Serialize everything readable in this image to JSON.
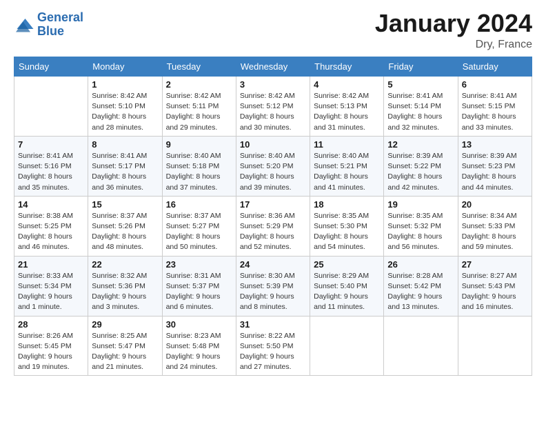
{
  "header": {
    "logo_line1": "General",
    "logo_line2": "Blue",
    "month_title": "January 2024",
    "location": "Dry, France"
  },
  "days_of_week": [
    "Sunday",
    "Monday",
    "Tuesday",
    "Wednesday",
    "Thursday",
    "Friday",
    "Saturday"
  ],
  "weeks": [
    [
      {
        "day": "",
        "info": ""
      },
      {
        "day": "1",
        "info": "Sunrise: 8:42 AM\nSunset: 5:10 PM\nDaylight: 8 hours\nand 28 minutes."
      },
      {
        "day": "2",
        "info": "Sunrise: 8:42 AM\nSunset: 5:11 PM\nDaylight: 8 hours\nand 29 minutes."
      },
      {
        "day": "3",
        "info": "Sunrise: 8:42 AM\nSunset: 5:12 PM\nDaylight: 8 hours\nand 30 minutes."
      },
      {
        "day": "4",
        "info": "Sunrise: 8:42 AM\nSunset: 5:13 PM\nDaylight: 8 hours\nand 31 minutes."
      },
      {
        "day": "5",
        "info": "Sunrise: 8:41 AM\nSunset: 5:14 PM\nDaylight: 8 hours\nand 32 minutes."
      },
      {
        "day": "6",
        "info": "Sunrise: 8:41 AM\nSunset: 5:15 PM\nDaylight: 8 hours\nand 33 minutes."
      }
    ],
    [
      {
        "day": "7",
        "info": "Sunrise: 8:41 AM\nSunset: 5:16 PM\nDaylight: 8 hours\nand 35 minutes."
      },
      {
        "day": "8",
        "info": "Sunrise: 8:41 AM\nSunset: 5:17 PM\nDaylight: 8 hours\nand 36 minutes."
      },
      {
        "day": "9",
        "info": "Sunrise: 8:40 AM\nSunset: 5:18 PM\nDaylight: 8 hours\nand 37 minutes."
      },
      {
        "day": "10",
        "info": "Sunrise: 8:40 AM\nSunset: 5:20 PM\nDaylight: 8 hours\nand 39 minutes."
      },
      {
        "day": "11",
        "info": "Sunrise: 8:40 AM\nSunset: 5:21 PM\nDaylight: 8 hours\nand 41 minutes."
      },
      {
        "day": "12",
        "info": "Sunrise: 8:39 AM\nSunset: 5:22 PM\nDaylight: 8 hours\nand 42 minutes."
      },
      {
        "day": "13",
        "info": "Sunrise: 8:39 AM\nSunset: 5:23 PM\nDaylight: 8 hours\nand 44 minutes."
      }
    ],
    [
      {
        "day": "14",
        "info": "Sunrise: 8:38 AM\nSunset: 5:25 PM\nDaylight: 8 hours\nand 46 minutes."
      },
      {
        "day": "15",
        "info": "Sunrise: 8:37 AM\nSunset: 5:26 PM\nDaylight: 8 hours\nand 48 minutes."
      },
      {
        "day": "16",
        "info": "Sunrise: 8:37 AM\nSunset: 5:27 PM\nDaylight: 8 hours\nand 50 minutes."
      },
      {
        "day": "17",
        "info": "Sunrise: 8:36 AM\nSunset: 5:29 PM\nDaylight: 8 hours\nand 52 minutes."
      },
      {
        "day": "18",
        "info": "Sunrise: 8:35 AM\nSunset: 5:30 PM\nDaylight: 8 hours\nand 54 minutes."
      },
      {
        "day": "19",
        "info": "Sunrise: 8:35 AM\nSunset: 5:32 PM\nDaylight: 8 hours\nand 56 minutes."
      },
      {
        "day": "20",
        "info": "Sunrise: 8:34 AM\nSunset: 5:33 PM\nDaylight: 8 hours\nand 59 minutes."
      }
    ],
    [
      {
        "day": "21",
        "info": "Sunrise: 8:33 AM\nSunset: 5:34 PM\nDaylight: 9 hours\nand 1 minute."
      },
      {
        "day": "22",
        "info": "Sunrise: 8:32 AM\nSunset: 5:36 PM\nDaylight: 9 hours\nand 3 minutes."
      },
      {
        "day": "23",
        "info": "Sunrise: 8:31 AM\nSunset: 5:37 PM\nDaylight: 9 hours\nand 6 minutes."
      },
      {
        "day": "24",
        "info": "Sunrise: 8:30 AM\nSunset: 5:39 PM\nDaylight: 9 hours\nand 8 minutes."
      },
      {
        "day": "25",
        "info": "Sunrise: 8:29 AM\nSunset: 5:40 PM\nDaylight: 9 hours\nand 11 minutes."
      },
      {
        "day": "26",
        "info": "Sunrise: 8:28 AM\nSunset: 5:42 PM\nDaylight: 9 hours\nand 13 minutes."
      },
      {
        "day": "27",
        "info": "Sunrise: 8:27 AM\nSunset: 5:43 PM\nDaylight: 9 hours\nand 16 minutes."
      }
    ],
    [
      {
        "day": "28",
        "info": "Sunrise: 8:26 AM\nSunset: 5:45 PM\nDaylight: 9 hours\nand 19 minutes."
      },
      {
        "day": "29",
        "info": "Sunrise: 8:25 AM\nSunset: 5:47 PM\nDaylight: 9 hours\nand 21 minutes."
      },
      {
        "day": "30",
        "info": "Sunrise: 8:23 AM\nSunset: 5:48 PM\nDaylight: 9 hours\nand 24 minutes."
      },
      {
        "day": "31",
        "info": "Sunrise: 8:22 AM\nSunset: 5:50 PM\nDaylight: 9 hours\nand 27 minutes."
      },
      {
        "day": "",
        "info": ""
      },
      {
        "day": "",
        "info": ""
      },
      {
        "day": "",
        "info": ""
      }
    ]
  ]
}
